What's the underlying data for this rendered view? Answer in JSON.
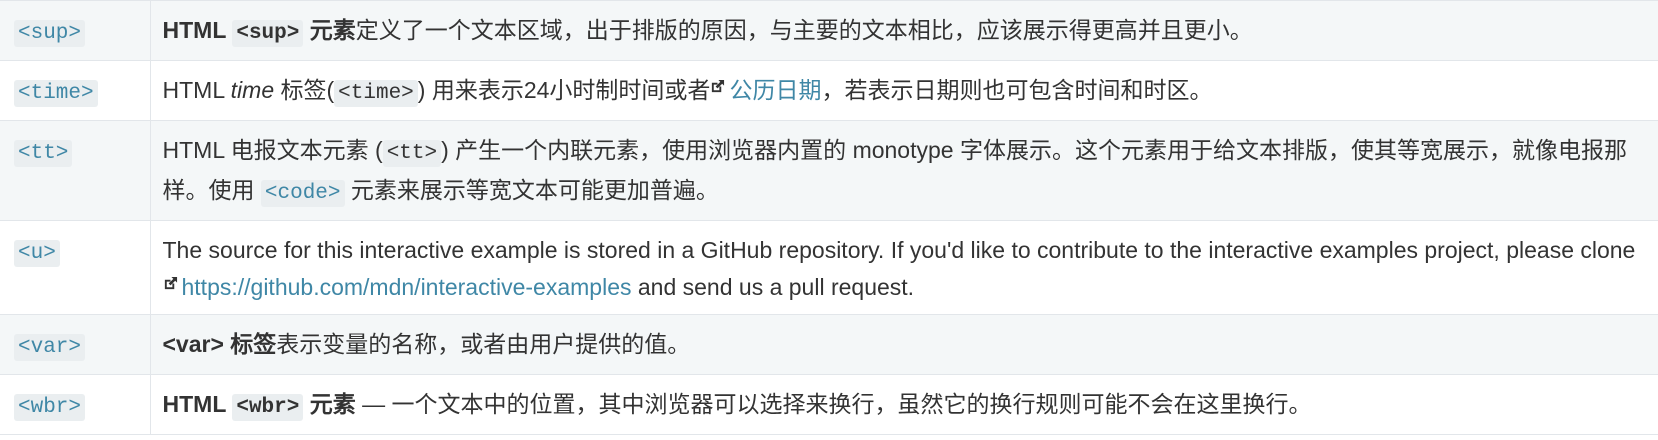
{
  "rows": [
    {
      "tag": "<sup>",
      "desc_bold_a": "HTML ",
      "desc_code": "<sup>",
      "desc_bold_b": " 元素",
      "desc_rest": "定义了一个文本区域，出于排版的原因，与主要的文本相比，应该展示得更高并且更小。"
    },
    {
      "tag": "<time>",
      "desc_a": "HTML ",
      "desc_italic": "time",
      "desc_b": " 标签(",
      "desc_code": "<time>",
      "desc_c": ") 用来表示24小时制时间或者",
      "desc_link": "公历日期",
      "desc_d": "，若表示日期则也可包含时间和时区。"
    },
    {
      "tag": "<tt>",
      "desc_a": "HTML 电报文本元素 (",
      "desc_code": "<tt>",
      "desc_b": ") 产生一个内联元素，使用浏览器内置的 monotype 字体展示。这个元素用于给文本排版，使其等宽展示，就像电报那样。使用 ",
      "desc_code2": "<code>",
      "desc_c": " 元素来展示等宽文本可能更加普遍。"
    },
    {
      "tag": "<u>",
      "desc_a": "The source for this interactive example is stored in a GitHub repository. If you'd like to contribute to the interactive examples project, please clone ",
      "desc_link": "https://github.com/mdn/interactive-examples",
      "desc_b": " and send us a pull request."
    },
    {
      "tag": "<var>",
      "desc_bold": "<var> 标签",
      "desc_rest": "表示变量的名称，或者由用户提供的值。"
    },
    {
      "tag": "<wbr>",
      "desc_bold_a": "HTML ",
      "desc_code": "<wbr>",
      "desc_bold_b": " 元素",
      "desc_rest": " — 一个文本中的位置，其中浏览器可以选择来换行，虽然它的换行规则可能不会在这里换行。"
    }
  ],
  "icons": {
    "external_link": "external-link-icon"
  },
  "colors": {
    "link": "#3f87a6",
    "row_alt": "#f4f7f8",
    "code_bg": "#eaeef0",
    "border": "#e2e6ea"
  }
}
